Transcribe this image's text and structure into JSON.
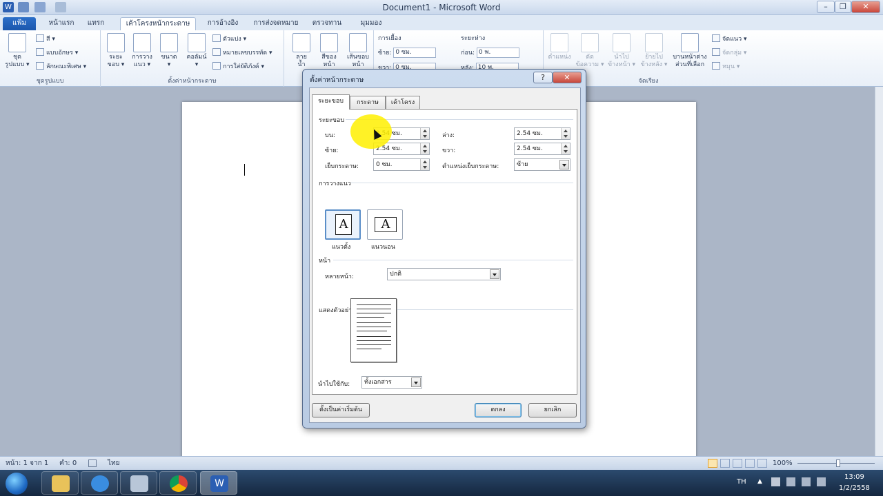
{
  "window": {
    "title": "Document1 - Microsoft Word"
  },
  "ribbon": {
    "tabs": [
      "แฟ้ม",
      "หน้าแรก",
      "แทรก",
      "เค้าโครงหน้ากระดาษ",
      "การอ้างอิง",
      "การส่งจดหมาย",
      "ตรวจทาน",
      "มุมมอง"
    ],
    "themes": {
      "themes_label": "ชุด",
      "themes_label2": "รูปแบบ ▾",
      "colors": "สี ▾",
      "fonts": "แบบอักษร ▾",
      "effects": "ลักษณะพิเศษ ▾",
      "group": "ชุดรูปแบบ"
    },
    "page_setup": {
      "margins": "ระยะ",
      "margins2": "ขอบ ▾",
      "orientation": "การวาง",
      "orientation2": "แนว ▾",
      "size": "ขนาด",
      "size2": "▾",
      "columns": "คอลัมน์",
      "columns2": "▾",
      "breaks": "ตัวแบ่ง ▾",
      "line_numbers": "หมายเลขบรรทัด ▾",
      "hyphenation": "การใส่ยัติภังค์ ▾",
      "group": "ตั้งค่าหน้ากระดาษ"
    },
    "page_bg": {
      "watermark": "ลาย",
      "watermark2": "น้ำ",
      "page_color": "สีของ",
      "page_color2": "หน้า",
      "page_borders": "เส้นขอบ",
      "page_borders2": "หน้ากระดาษ"
    },
    "paragraph": {
      "indent": "การเยื้อง",
      "indent_left": "ซ้าย:",
      "indent_left_val": "0 ซม.",
      "indent_right": "ขวา:",
      "indent_right_val": "0 ซม.",
      "spacing": "ระยะห่าง",
      "before": "ก่อน:",
      "before_val": "0 พ.",
      "after": "หลัง:",
      "after_val": "10 พ."
    },
    "arrange": {
      "position": "ตำแหน่ง",
      "wrap": "ตัด",
      "wrap2": "ข้อความ ▾",
      "bring_forward": "นำไป",
      "bring_forward2": "ข้างหน้า ▾",
      "send_backward": "ย้ายไป",
      "send_backward2": "ข้างหลัง ▾",
      "selection_pane": "บานหน้าต่าง",
      "selection_pane2": "ส่วนที่เลือก",
      "align": "จัดแนว ▾",
      "group_btn": "จัดกลุ่ม ▾",
      "rotate": "หมุน ▾",
      "group": "จัดเรียง"
    }
  },
  "dialog": {
    "title": "ตั้งค่าหน้ากระดาษ",
    "help": "?",
    "close": "✕",
    "tabs": [
      "ระยะขอบ",
      "กระดาษ",
      "เค้าโครง"
    ],
    "margins_section": "ระยะขอบ",
    "top_label": "บน:",
    "top_value": "2.54 ซม.",
    "bottom_label": "ล่าง:",
    "bottom_value": "2.54 ซม.",
    "left_label": "ซ้าย:",
    "left_value": "2.54 ซม.",
    "right_label": "ขวา:",
    "right_value": "2.54 ซม.",
    "gutter_label": "เย็บกระดาษ:",
    "gutter_value": "0 ซม.",
    "gutter_pos_label": "ตำแหน่งเย็บกระดาษ:",
    "gutter_pos_value": "ซ้าย",
    "orientation_section": "การวางแนว",
    "portrait": "แนวตั้ง",
    "landscape": "แนวนอน",
    "glyph": "A",
    "pages_section": "หน้า",
    "multiple_pages_label": "หลายหน้า:",
    "multiple_pages_value": "ปกติ",
    "preview_section": "แสดงตัวอย่าง",
    "apply_to_label": "นำไปใช้กับ:",
    "apply_to_value": "ทั้งเอกสาร",
    "set_default": "ตั้งเป็นค่าเริ่มต้น",
    "ok": "ตกลง",
    "cancel": "ยกเลิก"
  },
  "status": {
    "page": "หน้า: 1 จาก 1",
    "words": "คำ: 0",
    "language": "ไทย",
    "zoom": "100%"
  },
  "taskbar": {
    "lang": "TH",
    "time": "13:09",
    "date": "1/2/2558"
  }
}
